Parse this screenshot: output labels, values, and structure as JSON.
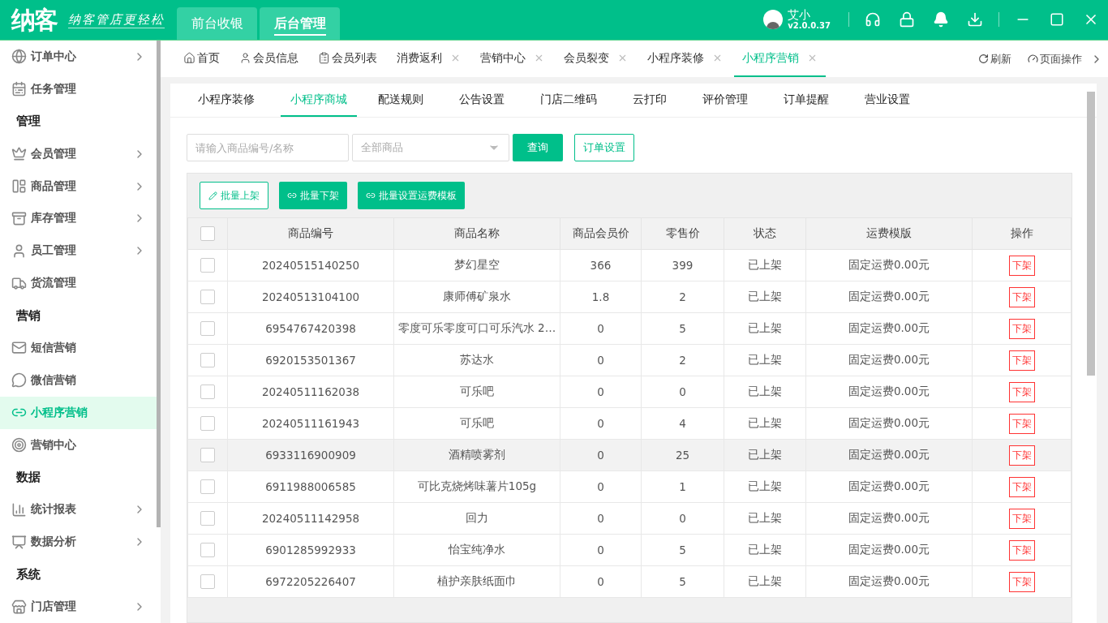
{
  "header": {
    "logo": "纳客",
    "slogan": "纳客管店更轻松",
    "tabs": [
      {
        "label": "前台收银",
        "selected": false
      },
      {
        "label": "后台管理",
        "selected": true
      }
    ],
    "user": {
      "name": "艾小",
      "version": "v2.0.0.37"
    }
  },
  "sidebar": {
    "items": [
      {
        "kind": "item",
        "label": "订单中心",
        "expandable": true,
        "selected": false
      },
      {
        "kind": "item",
        "label": "任务管理",
        "expandable": false,
        "selected": false
      },
      {
        "kind": "heading",
        "label": "管理"
      },
      {
        "kind": "item",
        "label": "会员管理",
        "expandable": true,
        "selected": false
      },
      {
        "kind": "item",
        "label": "商品管理",
        "expandable": true,
        "selected": false
      },
      {
        "kind": "item",
        "label": "库存管理",
        "expandable": true,
        "selected": false
      },
      {
        "kind": "item",
        "label": "员工管理",
        "expandable": true,
        "selected": false
      },
      {
        "kind": "item",
        "label": "货流管理",
        "expandable": false,
        "selected": false
      },
      {
        "kind": "heading",
        "label": "营销"
      },
      {
        "kind": "item",
        "label": "短信营销",
        "expandable": false,
        "selected": false
      },
      {
        "kind": "item",
        "label": "微信营销",
        "expandable": false,
        "selected": false
      },
      {
        "kind": "item",
        "label": "小程序营销",
        "expandable": false,
        "selected": true
      },
      {
        "kind": "item",
        "label": "营销中心",
        "expandable": false,
        "selected": false
      },
      {
        "kind": "heading",
        "label": "数据"
      },
      {
        "kind": "item",
        "label": "统计报表",
        "expandable": true,
        "selected": false
      },
      {
        "kind": "item",
        "label": "数据分析",
        "expandable": true,
        "selected": false
      },
      {
        "kind": "heading",
        "label": "系统"
      },
      {
        "kind": "item",
        "label": "门店管理",
        "expandable": true,
        "selected": false
      }
    ]
  },
  "page_tabs": {
    "tabs": [
      {
        "label": "首页",
        "closable": false,
        "selected": false
      },
      {
        "label": "会员信息",
        "closable": false,
        "selected": false
      },
      {
        "label": "会员列表",
        "closable": false,
        "selected": false
      },
      {
        "label": "消费返利",
        "closable": true,
        "selected": false
      },
      {
        "label": "营销中心",
        "closable": true,
        "selected": false
      },
      {
        "label": "会员裂变",
        "closable": true,
        "selected": false
      },
      {
        "label": "小程序装修",
        "closable": true,
        "selected": false
      },
      {
        "label": "小程序营销",
        "closable": true,
        "selected": true
      }
    ],
    "refresh": "刷新",
    "page_actions": "页面操作"
  },
  "sub_tabs": [
    {
      "label": "小程序装修",
      "selected": false
    },
    {
      "label": "小程序商城",
      "selected": true
    },
    {
      "label": "配送规则",
      "selected": false
    },
    {
      "label": "公告设置",
      "selected": false
    },
    {
      "label": "门店二维码",
      "selected": false
    },
    {
      "label": "云打印",
      "selected": false
    },
    {
      "label": "评价管理",
      "selected": false
    },
    {
      "label": "订单提醒",
      "selected": false
    },
    {
      "label": "营业设置",
      "selected": false
    }
  ],
  "filters": {
    "search_placeholder": "请输入商品编号/名称",
    "category_placeholder": "全部商品",
    "query_button": "查询",
    "order_settings_button": "订单设置"
  },
  "batch_buttons": [
    "批量上架",
    "批量下架",
    "批量设置运费模板"
  ],
  "table": {
    "select_all_checked": false,
    "columns": [
      "商品编号",
      "商品名称",
      "商品会员价",
      "零售价",
      "状态",
      "运费模版",
      "操作"
    ],
    "rows": [
      {
        "checked": false,
        "hovered": false,
        "cells": [
          "20240515140250",
          "梦幻星空",
          "366",
          "399",
          "已上架",
          "固定运费0.00元"
        ],
        "action": "下架"
      },
      {
        "checked": false,
        "hovered": false,
        "cells": [
          "20240513104100",
          "康师傅矿泉水",
          "1.8",
          "2",
          "已上架",
          "固定运费0.00元"
        ],
        "action": "下架"
      },
      {
        "checked": false,
        "hovered": false,
        "cells": [
          "6954767420398",
          "零度可乐零度可口可乐汽水 2…",
          "0",
          "5",
          "已上架",
          "固定运费0.00元"
        ],
        "action": "下架"
      },
      {
        "checked": false,
        "hovered": false,
        "cells": [
          "6920153501367",
          "苏达水",
          "0",
          "2",
          "已上架",
          "固定运费0.00元"
        ],
        "action": "下架"
      },
      {
        "checked": false,
        "hovered": false,
        "cells": [
          "20240511162038",
          "可乐吧",
          "0",
          "0",
          "已上架",
          "固定运费0.00元"
        ],
        "action": "下架"
      },
      {
        "checked": false,
        "hovered": false,
        "cells": [
          "20240511161943",
          "可乐吧",
          "0",
          "4",
          "已上架",
          "固定运费0.00元"
        ],
        "action": "下架"
      },
      {
        "checked": false,
        "hovered": true,
        "cells": [
          "6933116900909",
          "酒精喷雾剂",
          "0",
          "25",
          "已上架",
          "固定运费0.00元"
        ],
        "action": "下架"
      },
      {
        "checked": false,
        "hovered": false,
        "cells": [
          "6911988006585",
          "可比克烧烤味薯片105g",
          "0",
          "1",
          "已上架",
          "固定运费0.00元"
        ],
        "action": "下架"
      },
      {
        "checked": false,
        "hovered": false,
        "cells": [
          "20240511142958",
          "回力",
          "0",
          "0",
          "已上架",
          "固定运费0.00元"
        ],
        "action": "下架"
      },
      {
        "checked": false,
        "hovered": false,
        "cells": [
          "6901285992933",
          "怡宝纯净水",
          "0",
          "5",
          "已上架",
          "固定运费0.00元"
        ],
        "action": "下架"
      },
      {
        "checked": false,
        "hovered": false,
        "cells": [
          "6972205226407",
          "植护亲肤纸面巾",
          "0",
          "5",
          "已上架",
          "固定运费0.00元"
        ],
        "action": "下架"
      }
    ]
  }
}
